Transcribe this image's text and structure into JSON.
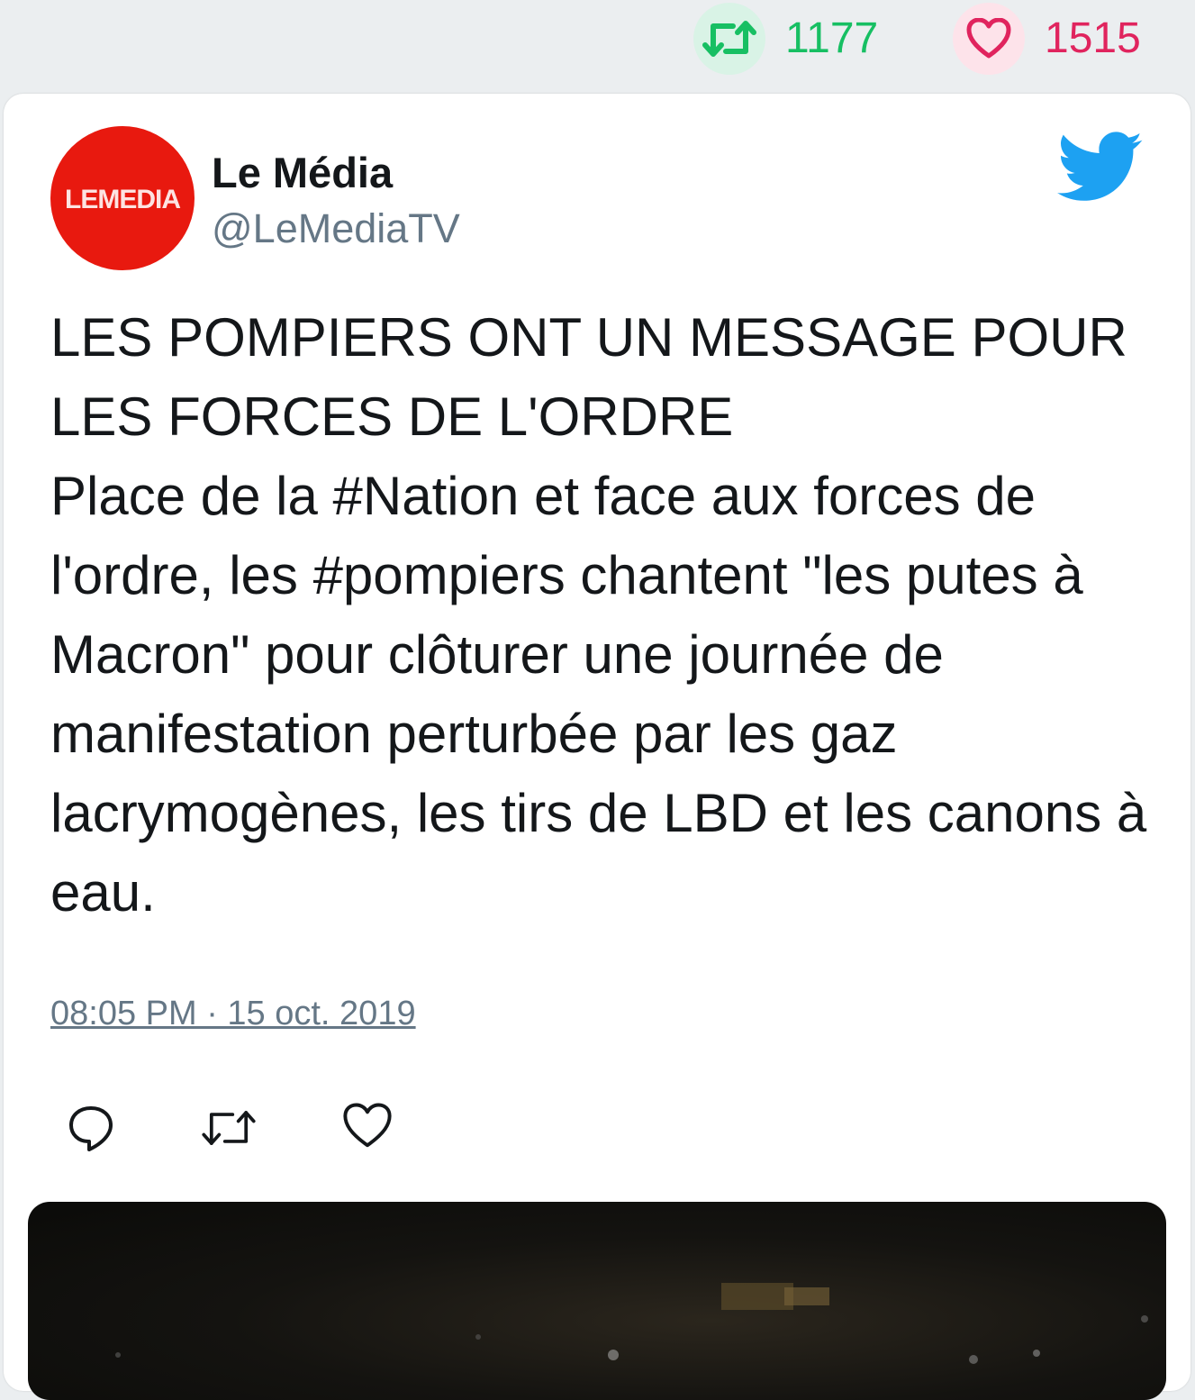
{
  "stats": {
    "retweets": "1177",
    "likes": "1515"
  },
  "tweet": {
    "author_name": "Le Média",
    "author_handle": "@LeMediaTV",
    "logo_text": "LE MEDIA",
    "text_line1": "LES POMPIERS ONT UN MESSAGE POUR LES FORCES DE L'ORDRE",
    "text_line2": "Place de la #Nation et face aux forces de l'ordre, les #pompiers chantent \"les putes à Macron\" pour clôturer une journée de manifestation perturbée par les gaz lacrymogènes, les tirs de LBD et les canons à eau.",
    "timestamp": "08:05 PM · 15 oct. 2019"
  },
  "icons": {
    "retweet": "retweet-icon",
    "like": "heart-icon",
    "reply": "reply-icon",
    "twitter": "twitter-bird-icon"
  },
  "colors": {
    "retweet_green": "#17bf63",
    "like_red": "#e0245e",
    "twitter_blue": "#1da1f2",
    "logo_red": "#e8190f"
  }
}
